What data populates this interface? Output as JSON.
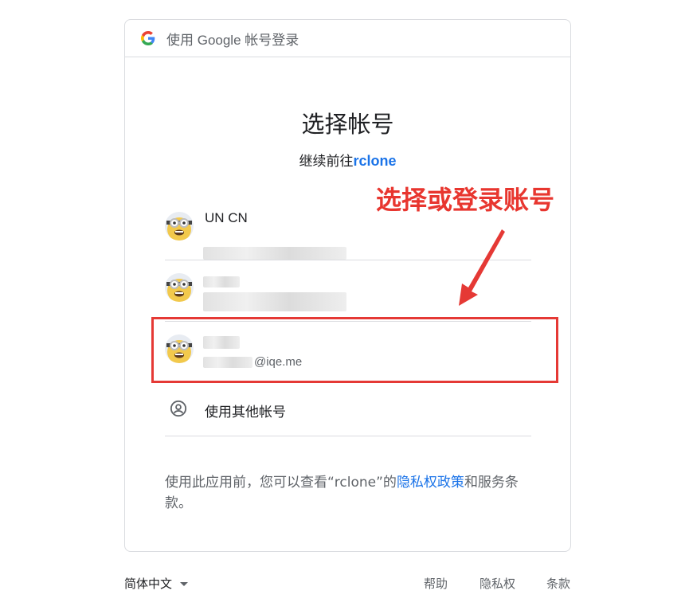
{
  "header": {
    "title": "使用 Google 帐号登录"
  },
  "main": {
    "title": "选择帐号",
    "subtitle_prefix": "继续前往",
    "app_name": "rclone"
  },
  "accounts": [
    {
      "name": "UN CN",
      "email": ""
    },
    {
      "name": "",
      "email": ""
    },
    {
      "name": "",
      "email": "@iqe.me"
    }
  ],
  "other_account": {
    "label": "使用其他帐号"
  },
  "privacy": {
    "text_before": "使用此应用前，您可以查看“rclone”的",
    "privacy_link": "隐私权政策",
    "text_middle": "和服务条款。"
  },
  "annotation": {
    "text": "选择或登录账号",
    "color": "#e8362f"
  },
  "footer": {
    "language": "简体中文",
    "help": "帮助",
    "privacy": "隐私权",
    "terms": "条款"
  },
  "colors": {
    "accent": "#1a73e8",
    "text": "#202124",
    "muted": "#5f6368",
    "highlight": "#e53935"
  }
}
